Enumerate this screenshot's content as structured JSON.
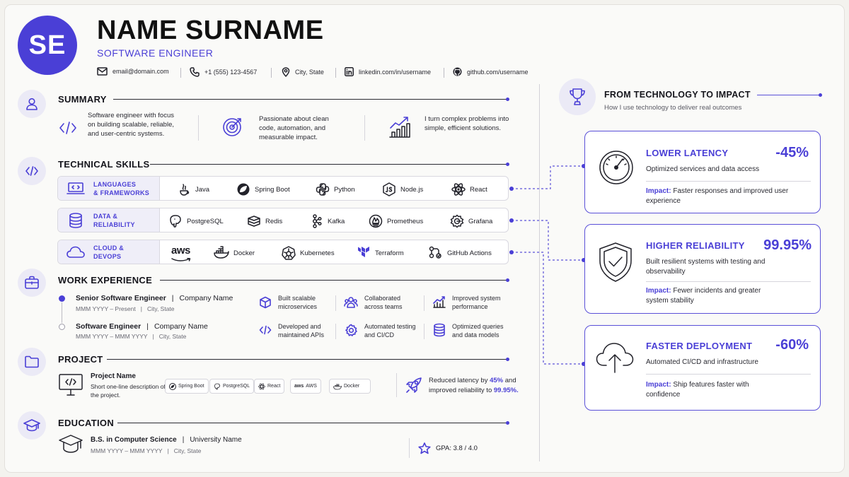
{
  "header": {
    "initials": "SE",
    "name": "NAME SURNAME",
    "role": "SOFTWARE ENGINEER",
    "contact": [
      {
        "icon": "mail-icon",
        "text": "email@domain.com"
      },
      {
        "icon": "phone-icon",
        "text": "+1 (555) 123-4567"
      },
      {
        "icon": "location-icon",
        "text": "City, State"
      },
      {
        "icon": "linkedin-icon",
        "text": "linkedin.com/in/username"
      },
      {
        "icon": "github-icon",
        "text": "github.com/username"
      }
    ]
  },
  "summary": {
    "title": "SUMMARY",
    "items": [
      {
        "icon": "code-icon",
        "text": "Software engineer with focus on building scalable, reliable, and user-centric systems."
      },
      {
        "icon": "target-icon",
        "text": "Passionate about clean code, automation, and measurable impact."
      },
      {
        "icon": "growth-chart-icon",
        "text": "I turn complex problems into simple, efficient solutions."
      }
    ]
  },
  "skills": {
    "title": "TECHNICAL SKILLS",
    "rows": [
      {
        "label_1": "LANGUAGES",
        "label_2": "& FRAMEWORKS",
        "items": [
          "Java",
          "Spring Boot",
          "Python",
          "Node.js",
          "React"
        ]
      },
      {
        "label_1": "DATA &",
        "label_2": "RELIABILITY",
        "items": [
          "PostgreSQL",
          "Redis",
          "Kafka",
          "Prometheus",
          "Grafana"
        ]
      },
      {
        "label_1": "CLOUD &",
        "label_2": "DEVOPS",
        "items": [
          "aws",
          "Docker",
          "Kubernetes",
          "Terraform",
          "GitHub Actions"
        ]
      }
    ]
  },
  "experience": {
    "title": "WORK EXPERIENCE",
    "jobs": [
      {
        "title": "Senior Software Engineer",
        "company": "Company Name",
        "dates": "MMM YYYY – Present",
        "location": "City, State",
        "highlights": [
          "Built scalable microservices",
          "Collaborated across teams",
          "Improved system performance"
        ]
      },
      {
        "title": "Software Engineer",
        "company": "Company Name",
        "dates": "MMM YYYY – MMM YYYY",
        "location": "City, State",
        "highlights": [
          "Developed and maintained APIs",
          "Automated testing and CI/CD",
          "Optimized queries and data models"
        ]
      }
    ]
  },
  "project": {
    "title": "PROJECT",
    "name": "Project Name",
    "description": "Short one-line description of the project.",
    "tags": [
      "Spring Boot",
      "PostgreSQL",
      "React",
      "AWS",
      "Docker"
    ],
    "result_prefix": "Reduced latency by",
    "latency": "45%",
    "result_mid": "and improved reliability to",
    "reliability": "99.95%."
  },
  "education": {
    "title": "EDUCATION",
    "degree": "B.S. in Computer Science",
    "school": "University Name",
    "dates": "MMM YYYY – MMM YYYY",
    "location": "City, State",
    "gpa": "GPA: 3.8 / 4.0"
  },
  "impact": {
    "title": "FROM TECHNOLOGY TO IMPACT",
    "subtitle": "How I use technology to deliver real outcomes",
    "impact_label": "Impact:",
    "cards": [
      {
        "title": "LOWER LATENCY",
        "value": "-45%",
        "description": "Optimized services and data access",
        "impact": "Faster responses and improved user experience"
      },
      {
        "title": "HIGHER RELIABILITY",
        "value": "99.95%",
        "description": "Built resilient systems with testing and observability",
        "impact": "Fewer incidents and greater system stability"
      },
      {
        "title": "FASTER DEPLOYMENT",
        "value": "-60%",
        "description": "Automated CI/CD and infrastructure",
        "impact": "Ship features faster with confidence"
      }
    ]
  },
  "colors": {
    "accent": "#4a3fd6",
    "text": "#1c1c24",
    "background": "#fafaf8"
  }
}
